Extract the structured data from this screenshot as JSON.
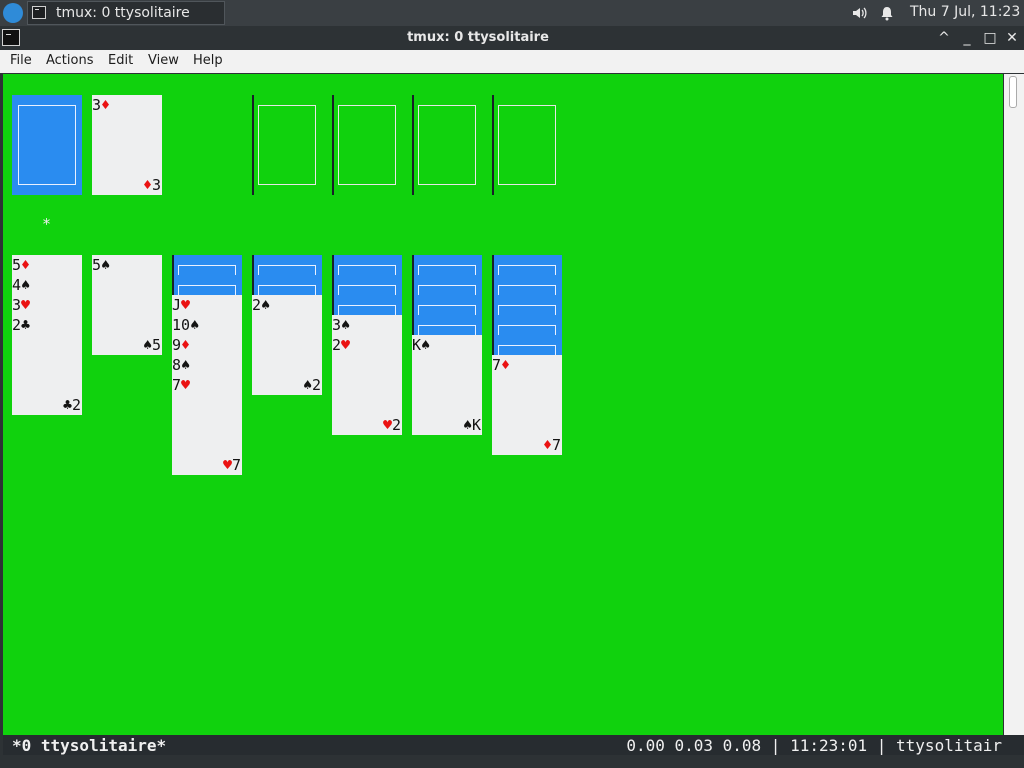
{
  "panel": {
    "task_label": "tmux: 0 ttysolitaire",
    "clock": "Thu  7 Jul, 11:23",
    "icons": [
      "volume-icon",
      "bell-icon"
    ]
  },
  "window": {
    "title": "tmux: 0 ttysolitaire",
    "buttons": [
      "^",
      "_",
      "□",
      "✕"
    ]
  },
  "menubar": {
    "items": [
      "File",
      "Actions",
      "Edit",
      "View",
      "Help"
    ]
  },
  "game": {
    "stock": "face-down",
    "waste": {
      "rank": "3",
      "suit": "♦",
      "color": "red"
    },
    "foundations": [
      "empty",
      "empty",
      "empty",
      "empty"
    ],
    "cursor_mark": "*",
    "tableau": [
      {
        "hidden": 0,
        "cards": [
          {
            "rank": "5",
            "suit": "♦",
            "red": true
          },
          {
            "rank": "4",
            "suit": "♠",
            "red": false
          },
          {
            "rank": "3",
            "suit": "♥",
            "red": true
          },
          {
            "rank": "2",
            "suit": "♣",
            "red": false
          }
        ]
      },
      {
        "hidden": 0,
        "cards": [
          {
            "rank": "5",
            "suit": "♠",
            "red": false
          }
        ]
      },
      {
        "hidden": 2,
        "cards": [
          {
            "rank": "J",
            "suit": "♥",
            "red": true
          },
          {
            "rank": "10",
            "suit": "♠",
            "red": false
          },
          {
            "rank": "9",
            "suit": "♦",
            "red": true
          },
          {
            "rank": "8",
            "suit": "♠",
            "red": false
          },
          {
            "rank": "7",
            "suit": "♥",
            "red": true
          }
        ]
      },
      {
        "hidden": 2,
        "cards": [
          {
            "rank": "2",
            "suit": "♠",
            "red": false
          }
        ]
      },
      {
        "hidden": 3,
        "cards": [
          {
            "rank": "3",
            "suit": "♠",
            "red": false
          },
          {
            "rank": "2",
            "suit": "♥",
            "red": true
          }
        ]
      },
      {
        "hidden": 4,
        "cards": [
          {
            "rank": "K",
            "suit": "♠",
            "red": false
          }
        ]
      },
      {
        "hidden": 5,
        "cards": [
          {
            "rank": "7",
            "suit": "♦",
            "red": true
          }
        ]
      }
    ]
  },
  "status": {
    "left": "*0 ttysolitaire*",
    "right": "0.00 0.03 0.08 | 11:23:01 | ttysolitair"
  },
  "colors": {
    "felt": "#10d20d",
    "card_back": "#2a8cf0",
    "card_face": "#eeeff0",
    "red_suit": "#ea1212"
  }
}
